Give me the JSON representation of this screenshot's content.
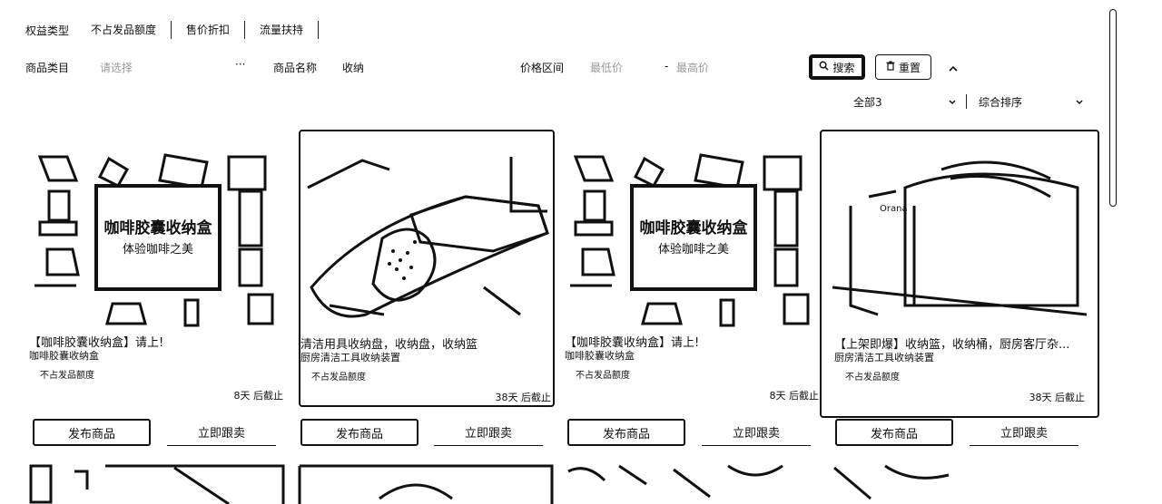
{
  "filters": {
    "benefit_label": "权益类型",
    "benefit_options": [
      "不占发品额度",
      "售价折扣",
      "流量扶持"
    ],
    "category_label": "商品类目",
    "category_placeholder": "请选择",
    "category_more": "···",
    "name_label": "商品名称",
    "name_value": "收纳",
    "price_label": "价格区间",
    "price_min_placeholder": "最低价",
    "price_dash": "-",
    "price_max_placeholder": "最高价",
    "search_label": "搜索",
    "reset_label": "重置",
    "collapse_icon": "chevron-up-icon"
  },
  "sort": {
    "filter_value": "全部3",
    "order_value": "综合排序"
  },
  "cards": [
    {
      "title": "【咖啡胶囊收纳盒】请上!",
      "subtitle": "咖啡胶囊收纳盒",
      "tag": "不占发品额度",
      "deadline": "8天 后截止",
      "image_text": "咖啡胶囊收纳盒",
      "image_subtext": "体验咖啡之美",
      "publish_label": "发布商品",
      "follow_label": "立即跟卖"
    },
    {
      "title": "清洁用具收纳盘，收纳盘，收纳篮",
      "subtitle": "厨房清洁工具收纳装置",
      "tag": "不占发品额度",
      "deadline": "38天 后截止",
      "publish_label": "发布商品",
      "follow_label": "立即跟卖"
    },
    {
      "title": "【咖啡胶囊收纳盒】请上!",
      "subtitle": "咖啡胶囊收纳盒",
      "tag": "不占发品额度",
      "deadline": "8天 后截止",
      "image_text": "咖啡胶囊收纳盒",
      "image_subtext": "体验咖啡之美",
      "publish_label": "发布商品",
      "follow_label": "立即跟卖"
    },
    {
      "title": "【上架即爆】收纳篮，收纳桶，厨房客厅杂...",
      "subtitle": "厨房清洁工具收纳装置",
      "tag": "不占发品额度",
      "deadline": "38天 后截止",
      "publish_label": "发布商品",
      "follow_label": "立即跟卖"
    }
  ]
}
